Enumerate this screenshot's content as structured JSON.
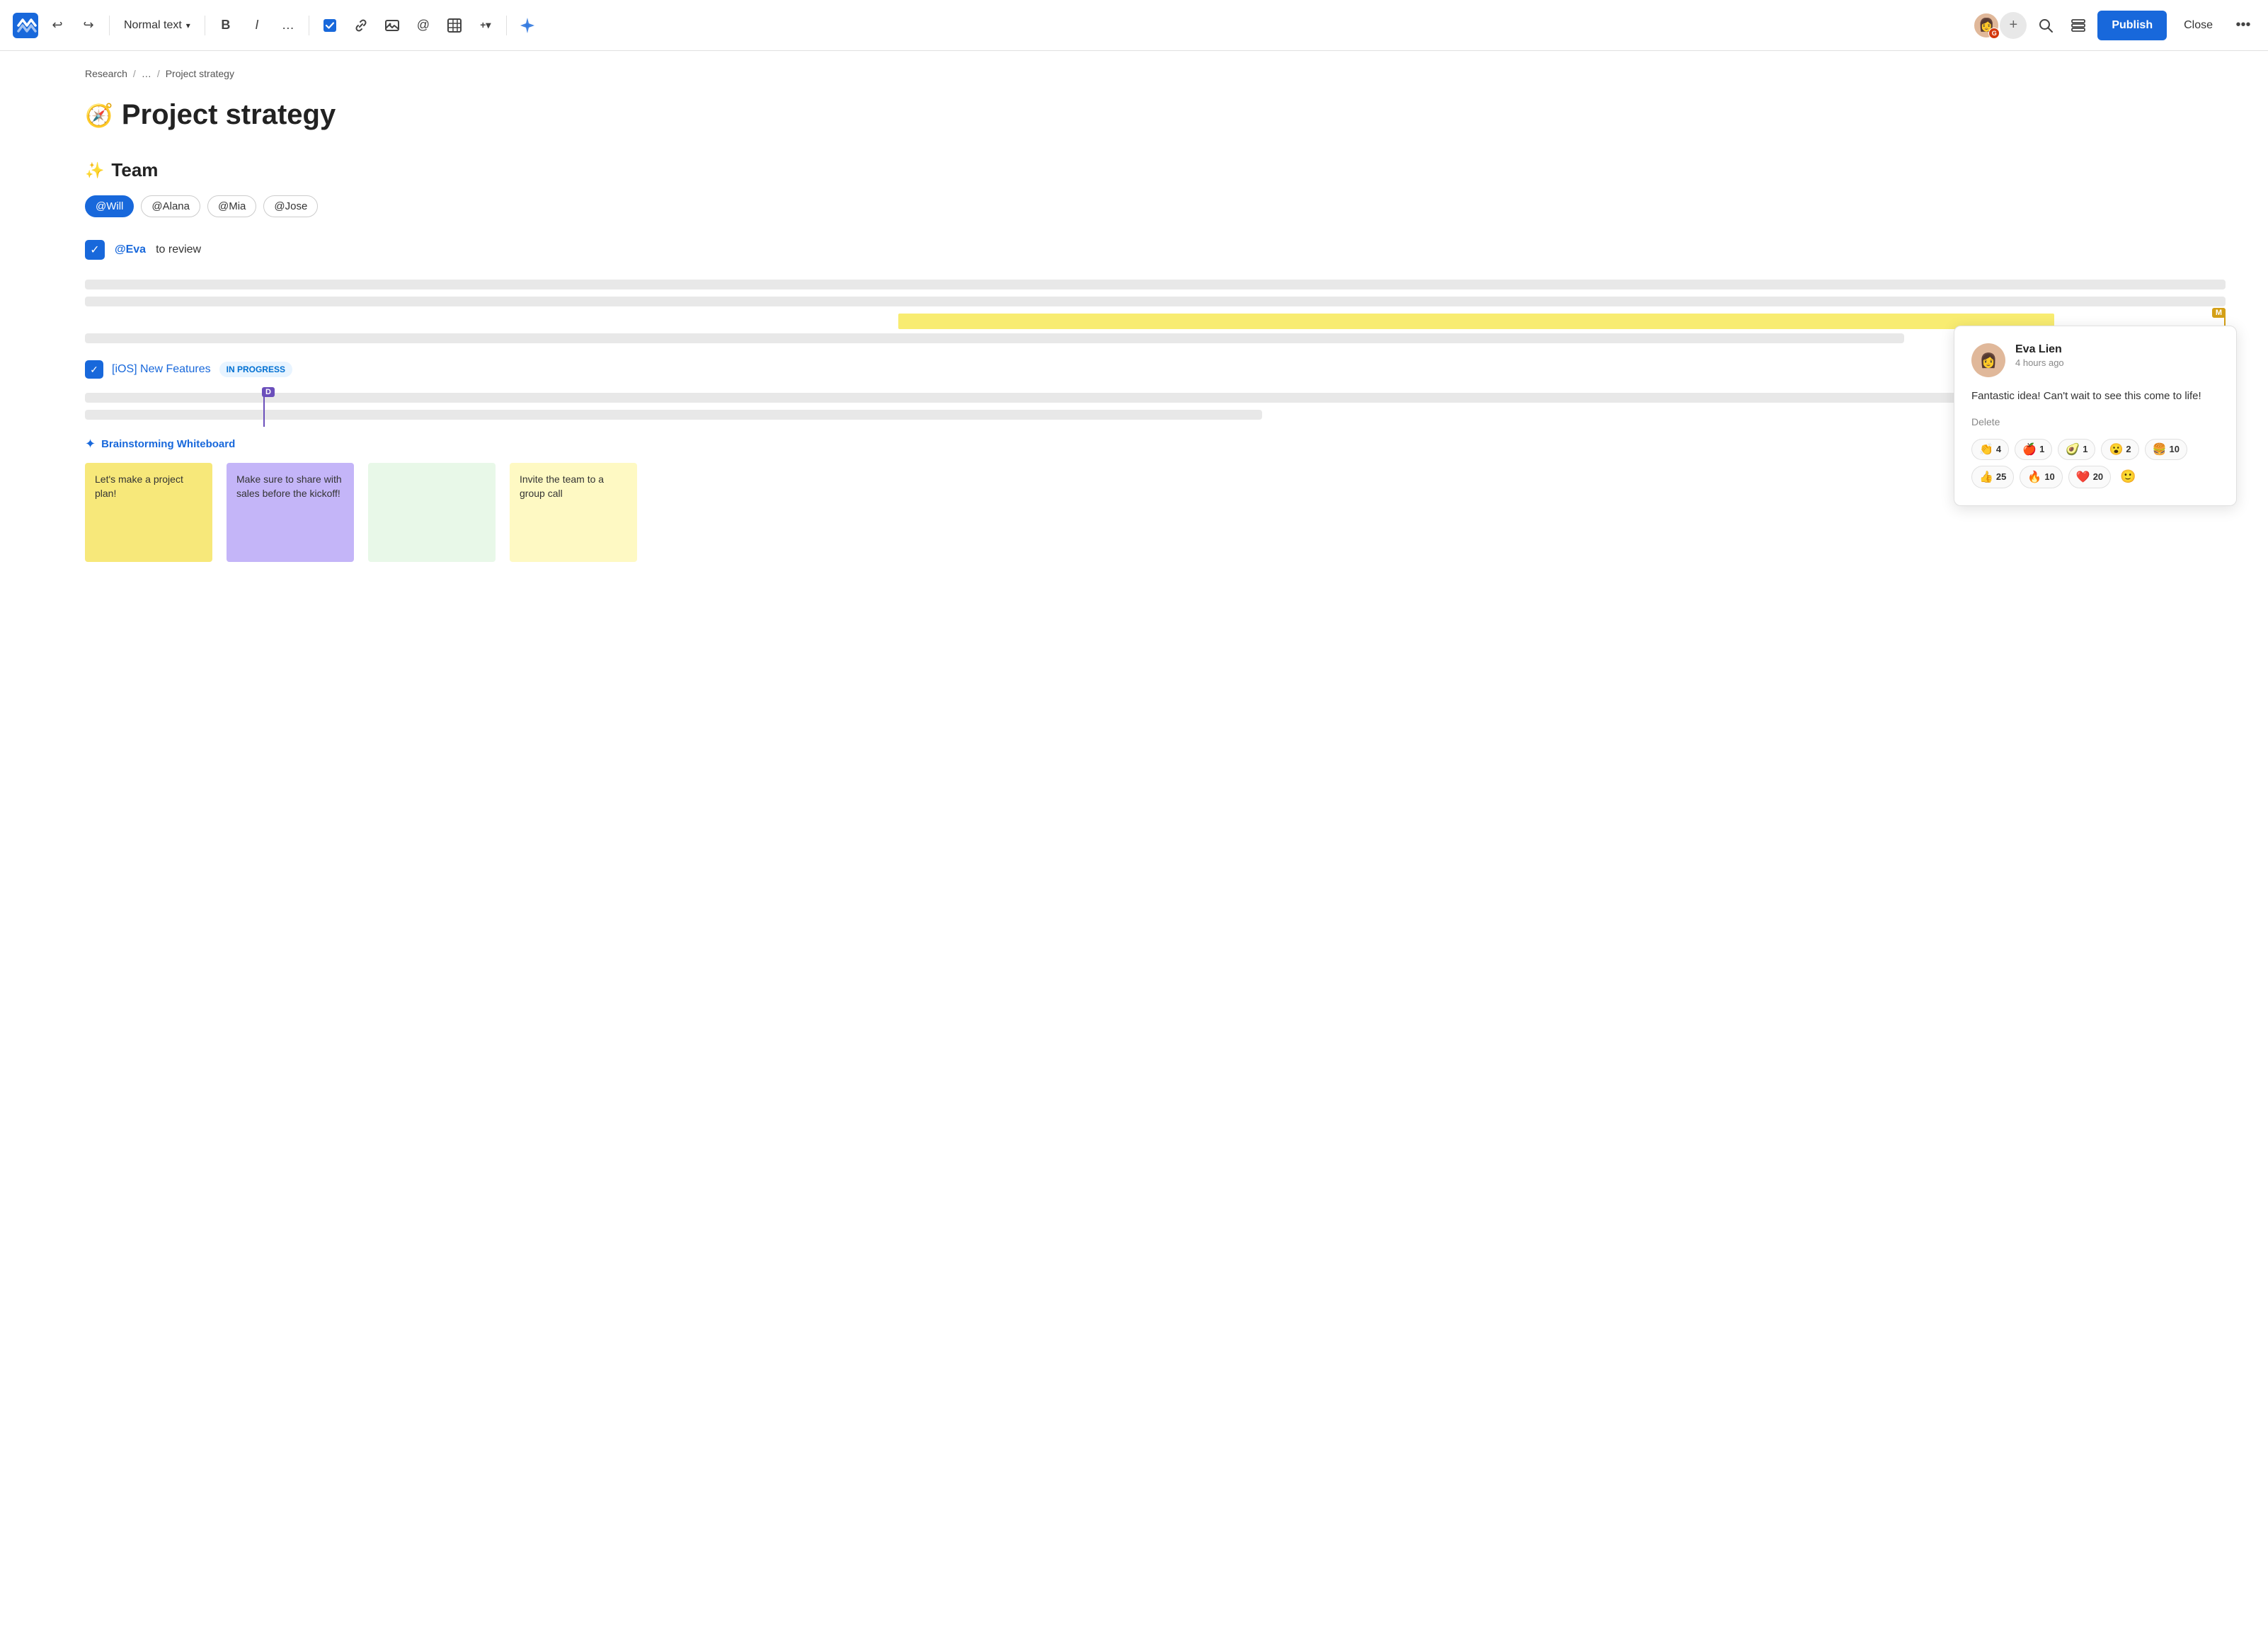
{
  "toolbar": {
    "text_format_label": "Normal text",
    "bold_label": "B",
    "italic_label": "I",
    "more_label": "…",
    "publish_label": "Publish",
    "close_label": "Close"
  },
  "breadcrumb": {
    "items": [
      "Research",
      "…",
      "Project strategy"
    ]
  },
  "page": {
    "title": "Project strategy",
    "sections": [
      {
        "heading": "Team",
        "tags": [
          "@Will",
          "@Alana",
          "@Mia",
          "@Jose"
        ]
      }
    ],
    "task": {
      "mention": "@Eva",
      "text": "to review"
    },
    "ios_task": {
      "label": "[iOS] New Features",
      "status": "IN PROGRESS"
    }
  },
  "whiteboard": {
    "title": "Brainstorming Whiteboard",
    "notes": [
      {
        "text": "Let's make a project plan!",
        "color": "yellow"
      },
      {
        "text": "Make sure to share with sales before the kickoff!",
        "color": "purple"
      },
      {
        "text": "Invite the team to a group call",
        "color": "yellow-light"
      }
    ]
  },
  "comment": {
    "author": "Eva Lien",
    "time": "4 hours ago",
    "text": "Fantastic idea! Can't wait to see this come to life!",
    "delete_label": "Delete",
    "reactions": [
      {
        "emoji": "👏",
        "count": "4"
      },
      {
        "emoji": "🍎",
        "count": "1"
      },
      {
        "emoji": "🥑",
        "count": "1"
      },
      {
        "emoji": "😮",
        "count": "2"
      },
      {
        "emoji": "🍔",
        "count": "10"
      },
      {
        "emoji": "👍",
        "count": "25"
      },
      {
        "emoji": "🔥",
        "count": "10"
      },
      {
        "emoji": "❤️",
        "count": "20"
      }
    ]
  }
}
